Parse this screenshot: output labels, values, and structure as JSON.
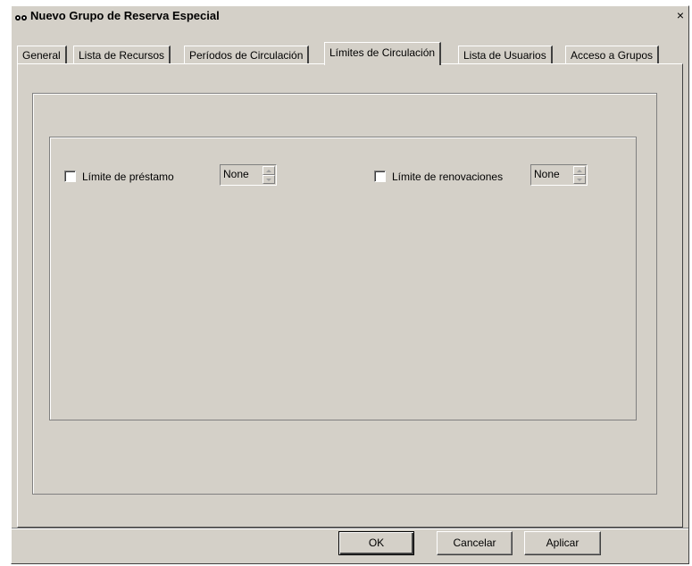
{
  "window": {
    "title": "Nuevo Grupo de Reserva Especial",
    "close_glyph": "×"
  },
  "tabs": [
    {
      "label": "General",
      "active": false
    },
    {
      "label": "Lista de Recursos",
      "active": false
    },
    {
      "label": "Períodos de Circulación",
      "active": false
    },
    {
      "label": "Límites de Circulación",
      "active": true
    },
    {
      "label": "Lista de Usuarios",
      "active": false
    },
    {
      "label": "Acceso a Grupos",
      "active": false
    }
  ],
  "limits": {
    "loan": {
      "label": "Límite de préstamo",
      "checked": false,
      "value": "None"
    },
    "renewals": {
      "label": "Límite de renovaciones",
      "checked": false,
      "value": "None"
    }
  },
  "buttons": {
    "ok": "OK",
    "cancel": "Cancelar",
    "apply": "Aplicar"
  },
  "colors": {
    "face": "#d4d0c8",
    "shadow": "#808080",
    "highlight": "#ffffff"
  },
  "icons": {
    "title": "app-window-icon",
    "close": "close-icon",
    "spin_up": "spin-up-arrow-icon",
    "spin_down": "spin-down-arrow-icon"
  }
}
